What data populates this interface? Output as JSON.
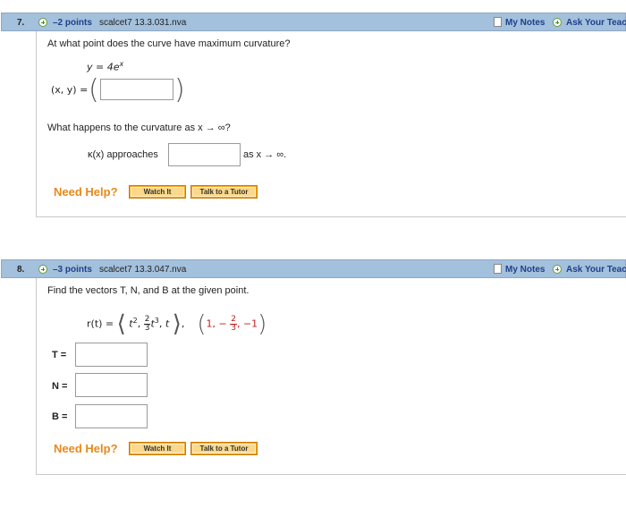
{
  "q7": {
    "number": "7.",
    "points": "–2 points",
    "source": "scalcet7 13.3.031.nva",
    "my_notes": "My Notes",
    "ask": "Ask Your Teac",
    "prompt1": "At what point does the curve have maximum curvature?",
    "equation": "y = 4e",
    "equation_sup": "x",
    "xy_label": "(x, y) =",
    "prompt2": "What happens to the curvature as  x → ∞?",
    "kappa_label": "κ(x) approaches",
    "as_label": "as x → ∞.",
    "need_help": "Need Help?",
    "watch_it": "Watch It",
    "talk_tutor": "Talk to a Tutor",
    "xy_value": "",
    "kappa_value": ""
  },
  "q8": {
    "number": "8.",
    "points": "–3 points",
    "source": "scalcet7 13.3.047.nva",
    "my_notes": "My Notes",
    "ask": "Ask Your Teac",
    "prompt": "Find the vectors T, N, and B at the given point.",
    "r_label": "r(t) =",
    "r_t2": "t",
    "r_frac_num": "2",
    "r_frac_den": "3",
    "r_t3": "t",
    "r_t": "t",
    "pt_1": "1",
    "pt_frac_num": "2",
    "pt_frac_den": "3",
    "pt_last": "−1",
    "t_label": "T =",
    "n_label": "N =",
    "b_label": "B =",
    "t_value": "",
    "n_value": "",
    "b_value": "",
    "need_help": "Need Help?",
    "watch_it": "Watch It",
    "talk_tutor": "Talk to a Tutor"
  },
  "colors": {
    "header_bg": "#a3c0dc",
    "link": "#1f3f8a",
    "help": "#e8891a",
    "button": "#f5a623",
    "point_red": "#c0211e"
  }
}
